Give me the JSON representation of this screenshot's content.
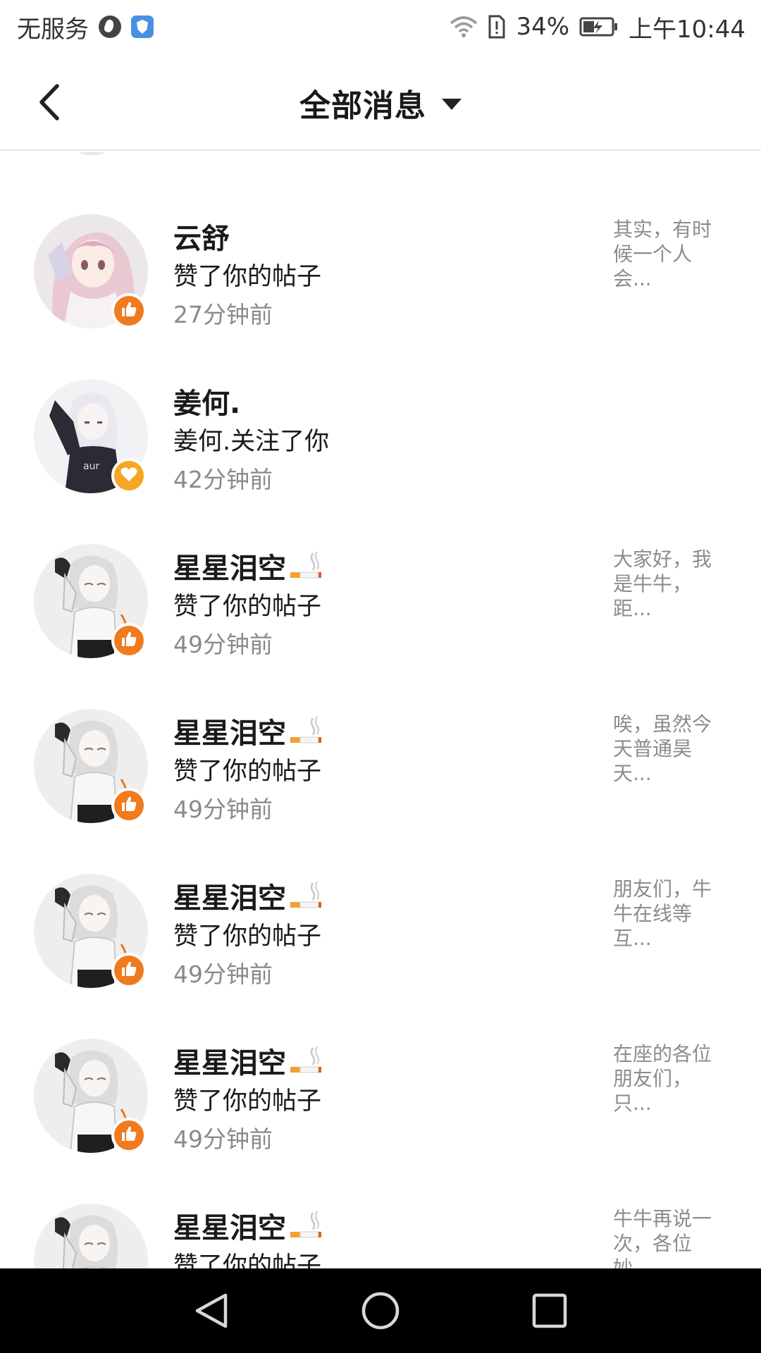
{
  "status_bar": {
    "carrier": "无服务",
    "battery": "34%",
    "time": "上午10:44"
  },
  "header": {
    "title": "全部消息"
  },
  "colors": {
    "like_badge": "#f07a1e",
    "follow_badge": "#f7a623",
    "secondary_text": "#8a8a8a",
    "divider": "#e6e6e6"
  },
  "notifications": [
    {
      "name": "云舒",
      "action": "赞了你的帖子",
      "time": "27分钟前",
      "preview": "其实，有时候一个人会...",
      "badge": "like-icon",
      "has_cigarette": false
    },
    {
      "name": "姜何.",
      "action": "姜何.关注了你",
      "time": "42分钟前",
      "preview": "",
      "badge": "heart-icon",
      "has_cigarette": false
    },
    {
      "name": "星星泪空",
      "action": "赞了你的帖子",
      "time": "49分钟前",
      "preview": "大家好，我是牛牛，距...",
      "badge": "like-icon",
      "has_cigarette": true
    },
    {
      "name": "星星泪空",
      "action": "赞了你的帖子",
      "time": "49分钟前",
      "preview": "唉，虽然今天普通昊天...",
      "badge": "like-icon",
      "has_cigarette": true
    },
    {
      "name": "星星泪空",
      "action": "赞了你的帖子",
      "time": "49分钟前",
      "preview": "朋友们，牛牛在线等互...",
      "badge": "like-icon",
      "has_cigarette": true
    },
    {
      "name": "星星泪空",
      "action": "赞了你的帖子",
      "time": "49分钟前",
      "preview": "在座的各位朋友们，只...",
      "badge": "like-icon",
      "has_cigarette": true
    },
    {
      "name": "星星泪空",
      "action": "赞了你的帖子",
      "time": "",
      "preview": "牛牛再说一次，各位妙...",
      "badge": "like-icon",
      "has_cigarette": true
    }
  ]
}
